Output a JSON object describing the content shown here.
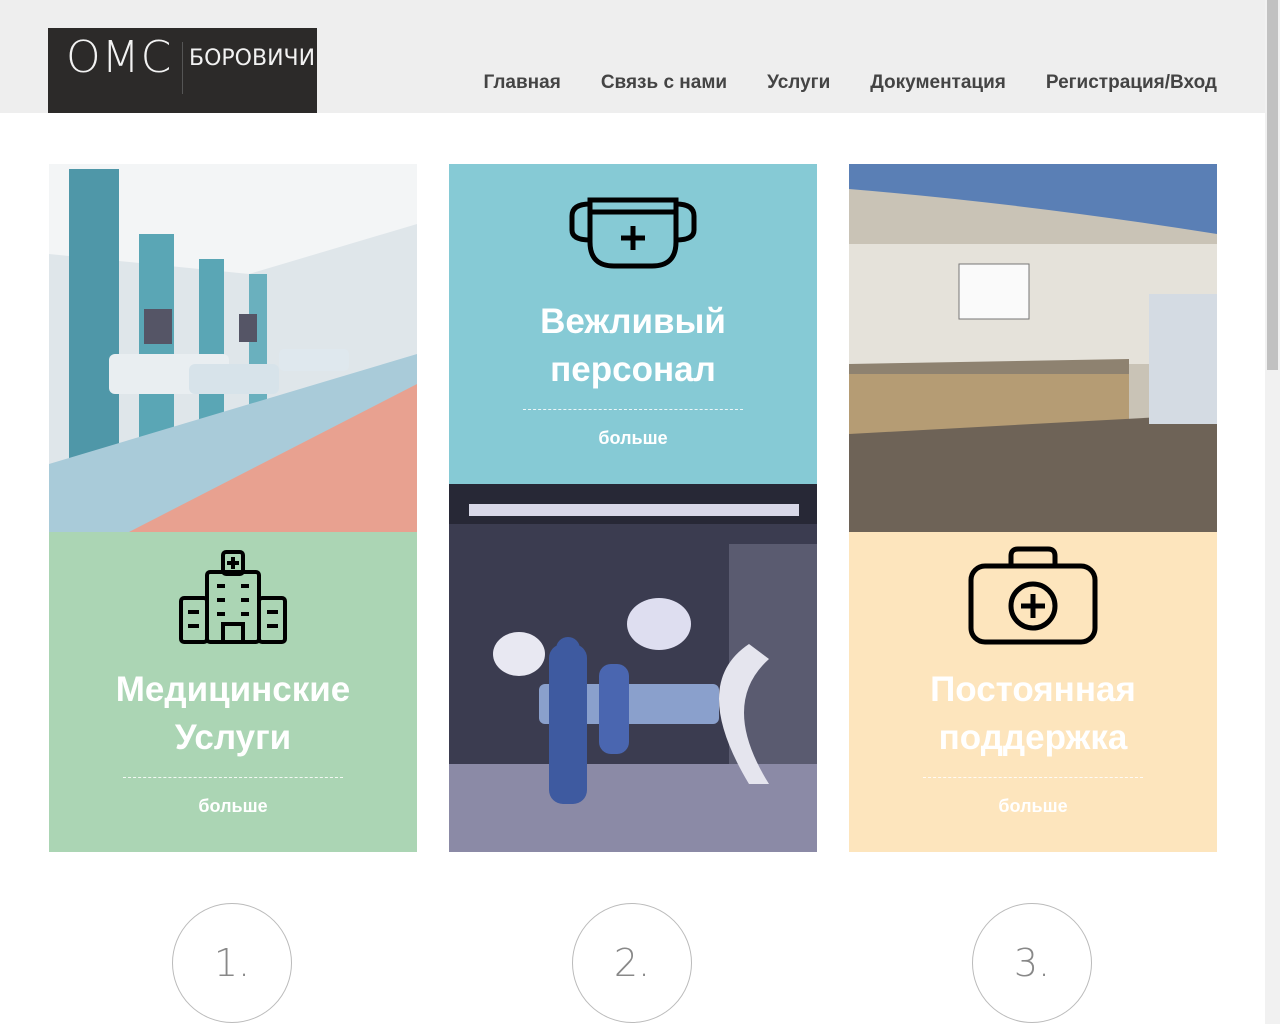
{
  "logo": {
    "main": "ОМС",
    "sub": "БОРОВИЧИ"
  },
  "nav": [
    "Главная",
    "Связь с нами",
    "Услуги",
    "Документация",
    "Регистрация/Вход"
  ],
  "tiles": [
    {
      "title_line1": "Медицинские",
      "title_line2": "Услуги",
      "more": "больше",
      "color": "#abd5b4",
      "icon": "hospital-icon"
    },
    {
      "title_line1": "Вежливый",
      "title_line2": "персонал",
      "more": "больше",
      "color": "#86cad5",
      "icon": "medical-mask-icon"
    },
    {
      "title_line1": "Постоянная",
      "title_line2": "поддержка",
      "more": "больше",
      "color": "#fde5bd",
      "icon": "first-aid-kit-icon"
    }
  ],
  "photos": [
    "hospital-ward-photo",
    "operating-room-photo",
    "reception-desk-photo"
  ],
  "steps": [
    "1.",
    "2.",
    "3."
  ]
}
